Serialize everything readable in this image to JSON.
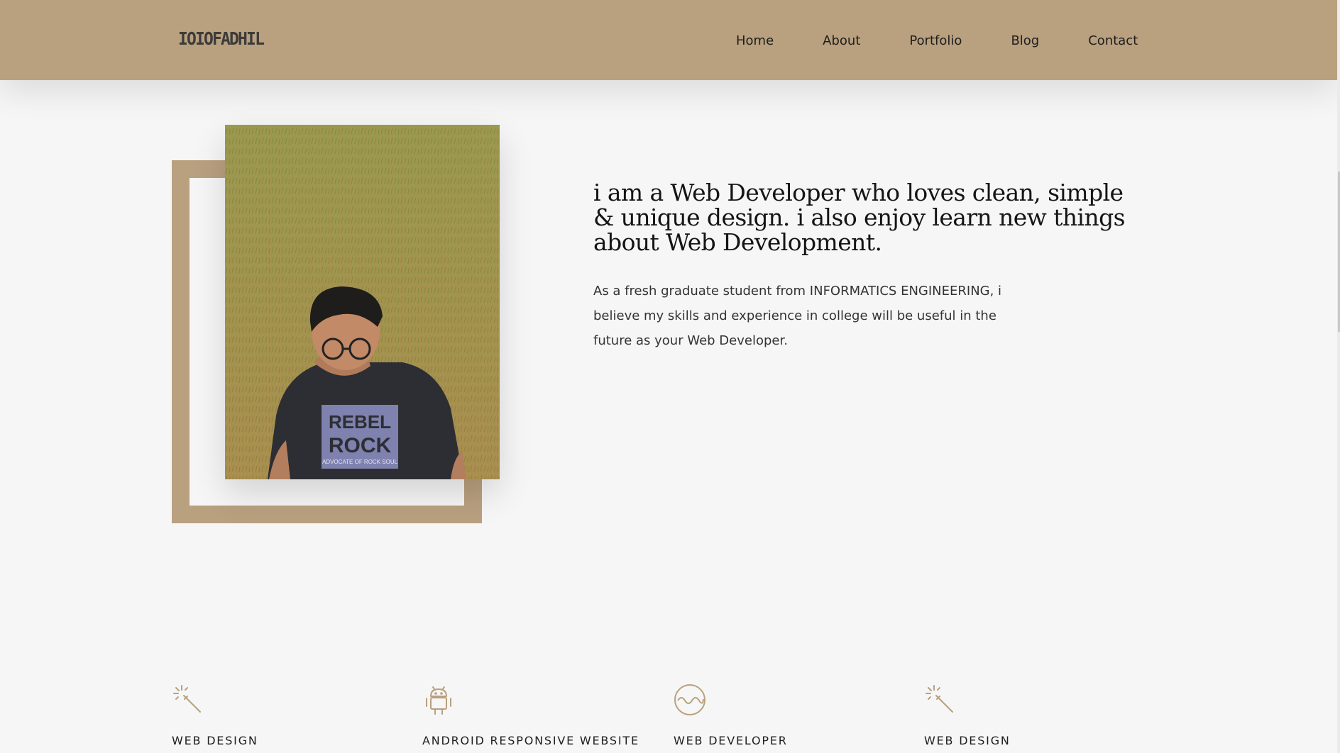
{
  "header": {
    "logo": "IOIOFADHIL",
    "nav": [
      "Home",
      "About",
      "Portfolio",
      "Blog",
      "Contact"
    ]
  },
  "hero": {
    "headline": "i am a Web Developer who loves clean, simple & unique design. i also enjoy learn new things about Web Development.",
    "intro": "As a fresh graduate student from INFORMATICS ENGINEERING, i believe my skills and experience in college will be useful in the future as your Web Developer.",
    "photo_shirt_text": [
      "REBEL",
      "ROCK",
      "ADVOCATE OF ROCK SOUL"
    ]
  },
  "services": [
    {
      "icon": "magic-wand-icon",
      "label": "WEB DESIGN"
    },
    {
      "icon": "android-icon",
      "label": "ANDROID RESPONSIVE WEBSITE"
    },
    {
      "icon": "wave-circle-icon",
      "label": "WEB DEVELOPER"
    },
    {
      "icon": "magic-wand-icon",
      "label": "WEB DESIGN"
    }
  ],
  "colors": {
    "accent": "#b9a07f",
    "background": "#f6f6f6",
    "text": "#1e1e1e"
  }
}
